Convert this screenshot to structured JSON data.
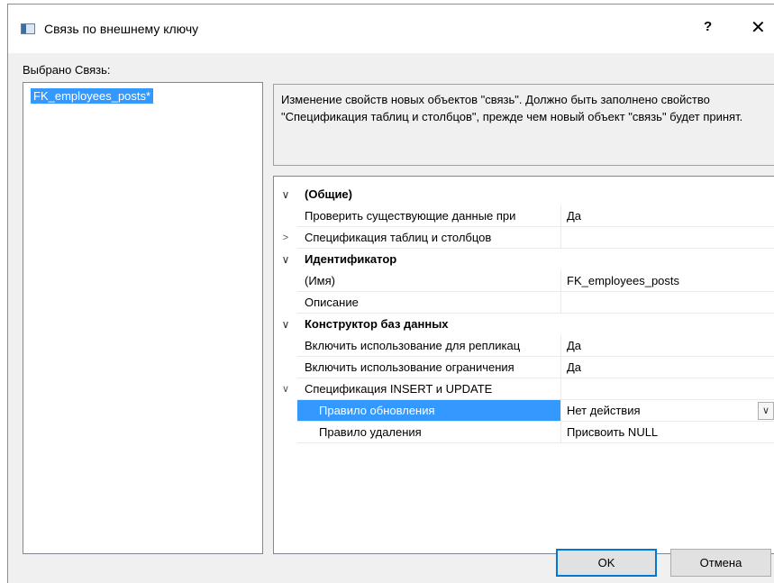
{
  "window": {
    "title": "Связь по внешнему ключу",
    "help_label": "?",
    "close_label": "✕"
  },
  "left_panel": {
    "label": "Выбрано Связь:",
    "items": [
      "FK_employees_posts*"
    ]
  },
  "description": "Изменение свойств новых объектов \"связь\".  Должно быть заполнено свойство \"Спецификация таблиц и столбцов\", прежде чем новый объект \"связь\" будет принят.",
  "grid": {
    "rows": [
      {
        "kind": "cat",
        "expander": "∨",
        "name": "(Общие)",
        "value": ""
      },
      {
        "kind": "prop",
        "expander": "",
        "name": "Проверить существующие данные при",
        "value": "Да"
      },
      {
        "kind": "prop",
        "expander": ">",
        "name": "Спецификация таблиц и столбцов",
        "value": ""
      },
      {
        "kind": "cat",
        "expander": "∨",
        "name": "Идентификатор",
        "value": ""
      },
      {
        "kind": "prop",
        "expander": "",
        "name": "(Имя)",
        "value": "FK_employees_posts"
      },
      {
        "kind": "prop",
        "expander": "",
        "name": "Описание",
        "value": ""
      },
      {
        "kind": "cat",
        "expander": "∨",
        "name": "Конструктор баз данных",
        "value": ""
      },
      {
        "kind": "prop",
        "expander": "",
        "name": "Включить использование для репликац",
        "value": "Да"
      },
      {
        "kind": "prop",
        "expander": "",
        "name": "Включить использование ограничения",
        "value": "Да"
      },
      {
        "kind": "prop",
        "expander": "∨",
        "name": "Спецификация INSERT и UPDATE",
        "value": ""
      },
      {
        "kind": "sub",
        "expander": "",
        "name": "Правило обновления",
        "value": "Нет действия",
        "selected": true
      },
      {
        "kind": "sub",
        "expander": "",
        "name": "Правило удаления",
        "value": "Присвоить NULL"
      }
    ],
    "dropdown_icon": "chevron-down"
  },
  "buttons": {
    "ok": "OK",
    "cancel": "Отмена"
  },
  "colors": {
    "selection": "#3399ff",
    "dialog_bg": "#f0f0f0",
    "default_button_border": "#0078d7"
  }
}
